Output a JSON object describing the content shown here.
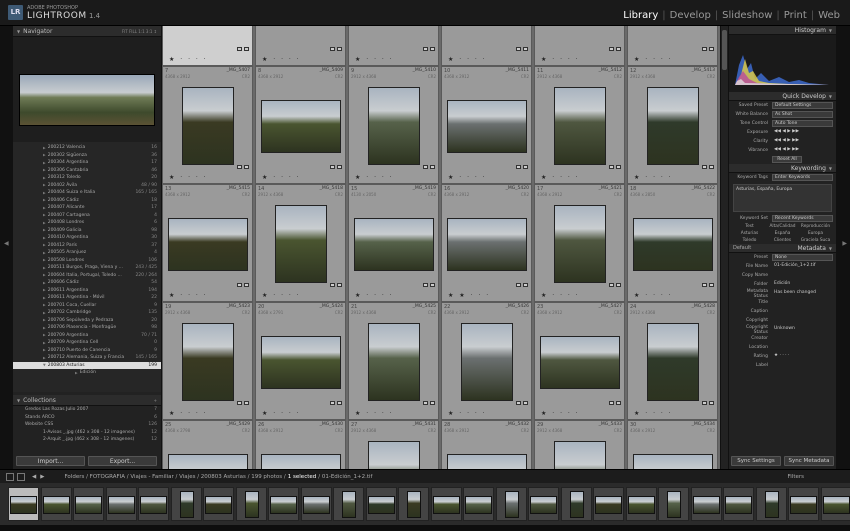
{
  "app": {
    "brand_top": "ADOBE PHOTOSHOP",
    "brand_name": "LIGHTROOM",
    "version": "1.4",
    "logo": "LR"
  },
  "modules": [
    {
      "label": "Library",
      "active": true
    },
    {
      "label": "Develop"
    },
    {
      "label": "Slideshow"
    },
    {
      "label": "Print"
    },
    {
      "label": "Web"
    }
  ],
  "navigator": {
    "title": "Navigator",
    "zoom_opts": "FIT  FILL  1:1  3:1 ↕"
  },
  "folders": [
    {
      "label": "200212 Valencia",
      "count": "16"
    },
    {
      "label": "200302 Sigüenza",
      "count": "36"
    },
    {
      "label": "200304 Argentina",
      "count": "17"
    },
    {
      "label": "200306 Cantabria",
      "count": "46"
    },
    {
      "label": "200312 Toledo",
      "count": "20"
    },
    {
      "label": "200402 Ávila",
      "count": "48 / 90"
    },
    {
      "label": "200404 Suiza e Italia",
      "count": "165 / 165"
    },
    {
      "label": "200406 Cádiz",
      "count": "18"
    },
    {
      "label": "200407 Alicante",
      "count": "17"
    },
    {
      "label": "200407 Cartagena",
      "count": "4"
    },
    {
      "label": "200408 Londres",
      "count": "6"
    },
    {
      "label": "200409 Galicia",
      "count": "98"
    },
    {
      "label": "200410 Argentina",
      "count": "30"
    },
    {
      "label": "200412 París",
      "count": "37"
    },
    {
      "label": "200505 Aranjuez",
      "count": "4"
    },
    {
      "label": "200508 Londres",
      "count": "106"
    },
    {
      "label": "200511 Burgos, Praga, Viena y ...",
      "count": "243 / 425"
    },
    {
      "label": "200604 Italia, Portugal, Toledo ...",
      "count": "220 / 264"
    },
    {
      "label": "200606 Cádiz",
      "count": "54"
    },
    {
      "label": "200611 Argentina",
      "count": "194"
    },
    {
      "label": "200611 Argentina - Móvil",
      "count": "22"
    },
    {
      "label": "200701 Coca, Cuellar",
      "count": "9"
    },
    {
      "label": "200702 Cambridge",
      "count": "135"
    },
    {
      "label": "200706 Sepúlveda y Pedraza",
      "count": "20"
    },
    {
      "label": "200706 Plasencia - Monfragüe",
      "count": "98"
    },
    {
      "label": "200709 Argentina",
      "count": "70 / 71"
    },
    {
      "label": "200709 Argentina Cell",
      "count": "0"
    },
    {
      "label": "200710 Puerto de Canencia",
      "count": "9"
    },
    {
      "label": "200712 Alemania, Suiza y Francia",
      "count": "145 / 165"
    },
    {
      "label": "200803 Asturias",
      "count": "199",
      "selected": true
    },
    {
      "label": "Edición",
      "count": "",
      "sub": true
    }
  ],
  "collections": {
    "title": "Collections",
    "items": [
      {
        "label": "Gredos Las Rozas Julio 2007",
        "count": "7"
      },
      {
        "label": "Stands ARCO",
        "count": "6"
      },
      {
        "label": "Website CSS",
        "count": "126"
      },
      {
        "label": "1-Avisos _.jpg (462 x 308 - 12 imagenes)",
        "count": "12"
      },
      {
        "label": "2-Arquit _.jpg (462 x 308 - 12 imagenes)",
        "count": "12"
      }
    ]
  },
  "buttons": {
    "import": "Import...",
    "export": "Export..."
  },
  "grid": {
    "cells": [
      {
        "num": "",
        "fn": "",
        "dims": "",
        "ext": "",
        "stars": "★ · · · ·"
      },
      {
        "num": "",
        "fn": "",
        "dims": "",
        "ext": "",
        "stars": "★ · · · ·"
      },
      {
        "num": "",
        "fn": "",
        "dims": "",
        "ext": "",
        "stars": "★ · · · ·"
      },
      {
        "num": "",
        "fn": "",
        "dims": "",
        "ext": "",
        "stars": "★ · · · ·"
      },
      {
        "num": "",
        "fn": "",
        "dims": "",
        "ext": "",
        "stars": "★ · · · ·"
      },
      {
        "num": "",
        "fn": "",
        "dims": "",
        "ext": "",
        "stars": "★ · · · ·"
      },
      {
        "num": "7",
        "fn": "_MG_5407",
        "dims": "4368 x 2912",
        "ext": "CR2",
        "stars": "★ · · · ·"
      },
      {
        "num": "8",
        "fn": "_MG_5409",
        "dims": "4368 x 2912",
        "ext": "CR2",
        "stars": "★ · · · ·"
      },
      {
        "num": "9",
        "fn": "_MG_5410",
        "dims": "2912 x 4368",
        "ext": "CR2",
        "stars": "★ · · · ·"
      },
      {
        "num": "10",
        "fn": "_MG_5411",
        "dims": "4368 x 2912",
        "ext": "CR2",
        "stars": "★ · · · ·"
      },
      {
        "num": "11",
        "fn": "_MG_5412",
        "dims": "2912 x 4368",
        "ext": "CR2",
        "stars": "★ · · · ·"
      },
      {
        "num": "12",
        "fn": "_MG_5413",
        "dims": "2912 x 4368",
        "ext": "CR2",
        "stars": "★ · · · ·"
      },
      {
        "num": "13",
        "fn": "_MG_5415",
        "dims": "4368 x 2912",
        "ext": "CR2",
        "stars": "★ · · · ·"
      },
      {
        "num": "14",
        "fn": "_MG_5418",
        "dims": "2912 x 4368",
        "ext": "CR2",
        "stars": "★ · · · ·"
      },
      {
        "num": "15",
        "fn": "_MG_5419",
        "dims": "4130 x 2050",
        "ext": "CR2",
        "stars": "★ · · · ·"
      },
      {
        "num": "16",
        "fn": "_MG_5420",
        "dims": "4368 x 2912",
        "ext": "CR2",
        "stars": "★ ★ · · ·"
      },
      {
        "num": "17",
        "fn": "_MG_5421",
        "dims": "4368 x 2912",
        "ext": "CR2",
        "stars": "★ · · · ·"
      },
      {
        "num": "18",
        "fn": "_MG_5422",
        "dims": "4368 x 2850",
        "ext": "CR2",
        "stars": "★ · · · ·"
      },
      {
        "num": "19",
        "fn": "_MG_5423",
        "dims": "2912 x 4368",
        "ext": "CR2",
        "stars": "★ · · · ·"
      },
      {
        "num": "20",
        "fn": "_MG_5424",
        "dims": "4368 x 2791",
        "ext": "CR2",
        "stars": "★ · · · ·"
      },
      {
        "num": "21",
        "fn": "_MG_5425",
        "dims": "2912 x 4368",
        "ext": "CR2",
        "stars": "★ · · · ·"
      },
      {
        "num": "22",
        "fn": "_MG_5426",
        "dims": "4368 x 2912",
        "ext": "CR2",
        "stars": "★ · · · ·"
      },
      {
        "num": "23",
        "fn": "_MG_5427",
        "dims": "4368 x 2912",
        "ext": "CR2",
        "stars": "★ · · · ·"
      },
      {
        "num": "24",
        "fn": "_MG_5428",
        "dims": "2912 x 4368",
        "ext": "CR2",
        "stars": "★ · · · ·"
      },
      {
        "num": "25",
        "fn": "_MG_5429",
        "dims": "4368 x 2798",
        "ext": "CR2",
        "stars": ""
      },
      {
        "num": "26",
        "fn": "_MG_5430",
        "dims": "4368 x 2912",
        "ext": "CR2",
        "stars": ""
      },
      {
        "num": "27",
        "fn": "_MG_5431",
        "dims": "2912 x 4368",
        "ext": "CR2",
        "stars": ""
      },
      {
        "num": "28",
        "fn": "_MG_5432",
        "dims": "4368 x 2912",
        "ext": "CR2",
        "stars": ""
      },
      {
        "num": "29",
        "fn": "_MG_5433",
        "dims": "2912 x 4368",
        "ext": "CR2",
        "stars": ""
      },
      {
        "num": "30",
        "fn": "_MG_5434",
        "dims": "4368 x 2912",
        "ext": "CR2",
        "stars": ""
      }
    ]
  },
  "right": {
    "histogram": "Histogram",
    "quick_develop": "Quick Develop",
    "saved_preset": {
      "label": "Saved Preset",
      "value": "Default Settings"
    },
    "white_balance": {
      "label": "White Balance",
      "value": "As Shot"
    },
    "tone_control": {
      "label": "Tone Control",
      "value": "Auto Tone"
    },
    "exposure": "Exposure",
    "clarity": "Clarity",
    "vibrance": "Vibrance",
    "reset_all": "Reset All",
    "keywording": "Keywording",
    "keyword_tags": {
      "label": "Keyword Tags",
      "value": "Enter Keywords"
    },
    "keywords_text": "Asturias, España, Europa",
    "keyword_set": {
      "label": "Keyword Set",
      "value": "Recent Keywords"
    },
    "kwset_items": [
      "Test",
      "Alta/Calidad",
      "Reproducción",
      "Asturias",
      "España",
      "Europa",
      "Toledo",
      "Clientes",
      "Graciela Suca"
    ],
    "metadata": "Metadata",
    "default_label": "Default",
    "preset": {
      "label": "Preset",
      "value": "None"
    },
    "file_name": {
      "label": "File Name",
      "value": "01-Edición_1+2.tif"
    },
    "copy_name": {
      "label": "Copy Name",
      "value": ""
    },
    "folder": {
      "label": "Folder",
      "value": "Edición"
    },
    "metadata_status": {
      "label": "Metadata Status",
      "value": "Has been changed"
    },
    "title_lbl": {
      "label": "Title",
      "value": ""
    },
    "caption": {
      "label": "Caption",
      "value": ""
    },
    "copyright": {
      "label": "Copyright",
      "value": ""
    },
    "copyright_status": {
      "label": "Copyright Status",
      "value": "Unknown"
    },
    "creator": {
      "label": "Creator",
      "value": ""
    },
    "location": {
      "label": "Location",
      "value": ""
    },
    "rating": {
      "label": "Rating",
      "value": "★ · · · ·"
    },
    "label_lbl": {
      "label": "Label",
      "value": ""
    },
    "sync_settings": "Sync Settings",
    "sync_metadata": "Sync Metadata"
  },
  "filmbar": {
    "path": "Folders / FOTOGRAFIA / Viajes - Familiar / Viajes / 200803 Asturias / 199 photos /",
    "selected": "1 selected",
    "file": "/ 01-Edición_1+2.tif",
    "filters": "Filters"
  }
}
